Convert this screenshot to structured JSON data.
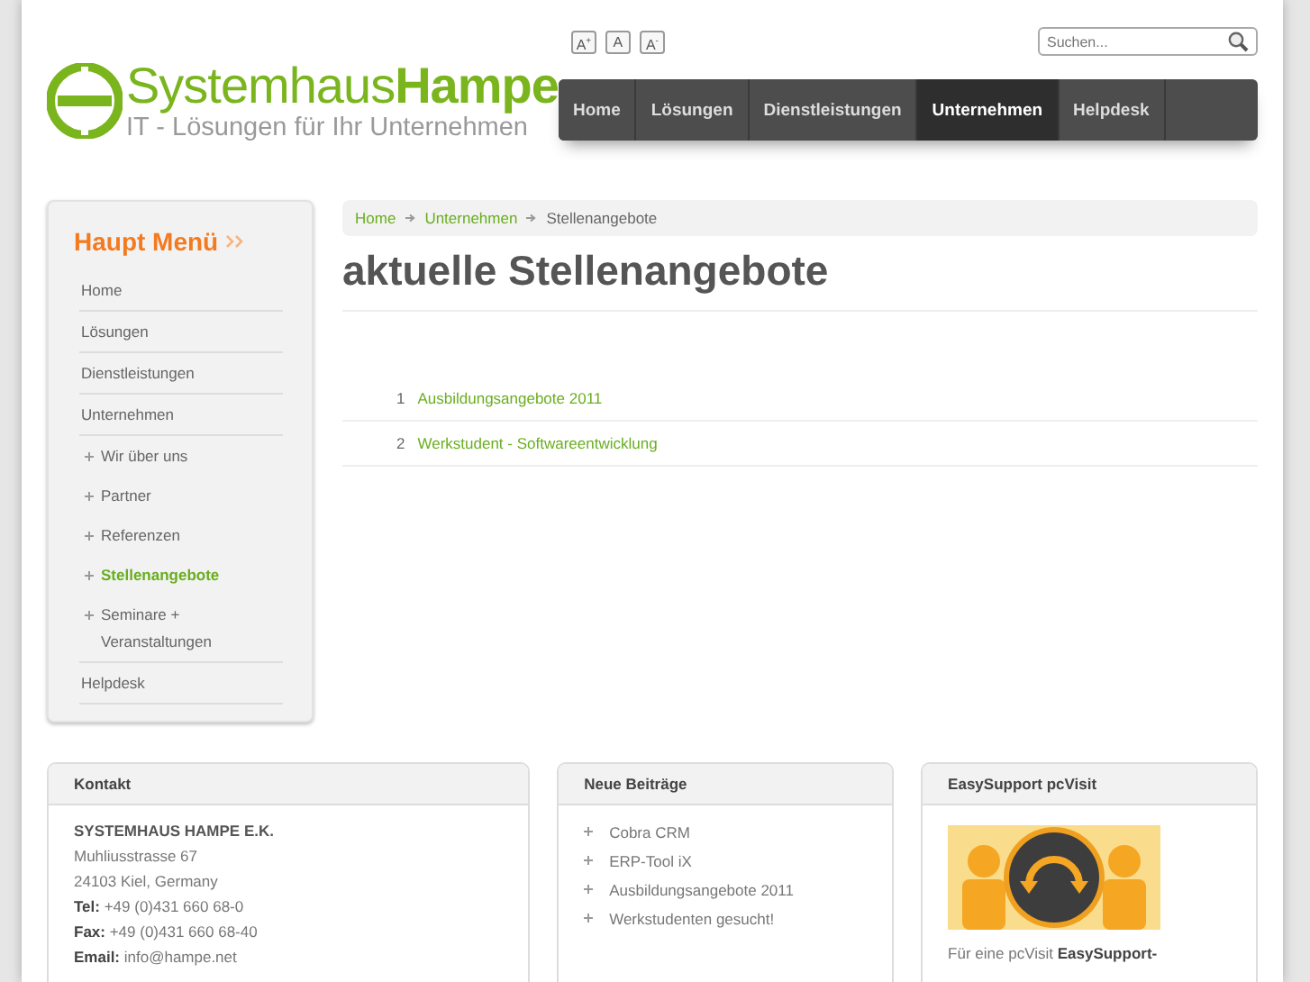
{
  "header": {
    "logo_title": "Systemhaus**Hampe**",
    "logo_subtitle": "IT - Lösungen für Ihr Unternehmen",
    "font_size_buttons": [
      "A$^{+}$",
      "A",
      "A$^{-}$"
    ],
    "search": {
      "placeholder": "Suchen..."
    }
  },
  "nav": [
    {
      "label": "Home",
      "selected": false
    },
    {
      "label": "Lösungen",
      "selected": false
    },
    {
      "label": "Dienstleistungen",
      "selected": false
    },
    {
      "label": "Unternehmen",
      "selected": true
    },
    {
      "label": "Helpdesk",
      "selected": false
    }
  ],
  "sidebar": {
    "title": "Haupt Menü",
    "items": [
      {
        "label": "Home",
        "selected": false
      },
      {
        "label": "Lösungen",
        "selected": false
      },
      {
        "label": "Dienstleistungen",
        "selected": false
      },
      {
        "label": "Unternehmen",
        "selected": false,
        "children": [
          {
            "label": "Wir über uns",
            "selected": false
          },
          {
            "label": "Partner",
            "selected": false
          },
          {
            "label": "Referenzen",
            "selected": false
          },
          {
            "label": "Stellenangebote",
            "selected": true
          },
          {
            "label": "Seminare + Veranstaltungen",
            "selected": false
          }
        ]
      },
      {
        "label": "Helpdesk",
        "selected": false
      }
    ]
  },
  "breadcrumb": [
    {
      "label": "Home",
      "kind": "link"
    },
    {
      "label": "Unternehmen",
      "kind": "link"
    },
    {
      "label": "Stellenangebote",
      "kind": "current"
    }
  ],
  "page_title": "aktuelle Stellenangebote",
  "list": [
    {
      "number": "1",
      "label": "Ausbildungsangebote 2011"
    },
    {
      "number": "2",
      "label": "Werkstudent - Softwareentwicklung"
    }
  ],
  "footer": [
    {
      "kind": "contact",
      "title": "Kontakt",
      "company": "SYSTEMHAUS HAMPE E.K.",
      "lines": [
        "Muhliusstrasse 67",
        "24103 Kiel, Germany",
        "**Tel:** +49 (0)431 660 68-0",
        "**Fax:** +49 (0)431 660 68-40",
        "**Email:** info@hampe.net"
      ]
    },
    {
      "kind": "posts",
      "title": "Neue Beiträge",
      "items": [
        "Cobra CRM",
        "ERP-Tool iX",
        "Ausbildungsangebote 2011",
        "Werkstudenten gesucht!"
      ]
    },
    {
      "kind": "promo",
      "title": "EasySupport pcVisit",
      "text": "Für eine pcVisit **EasySupport-**"
    }
  ]
}
